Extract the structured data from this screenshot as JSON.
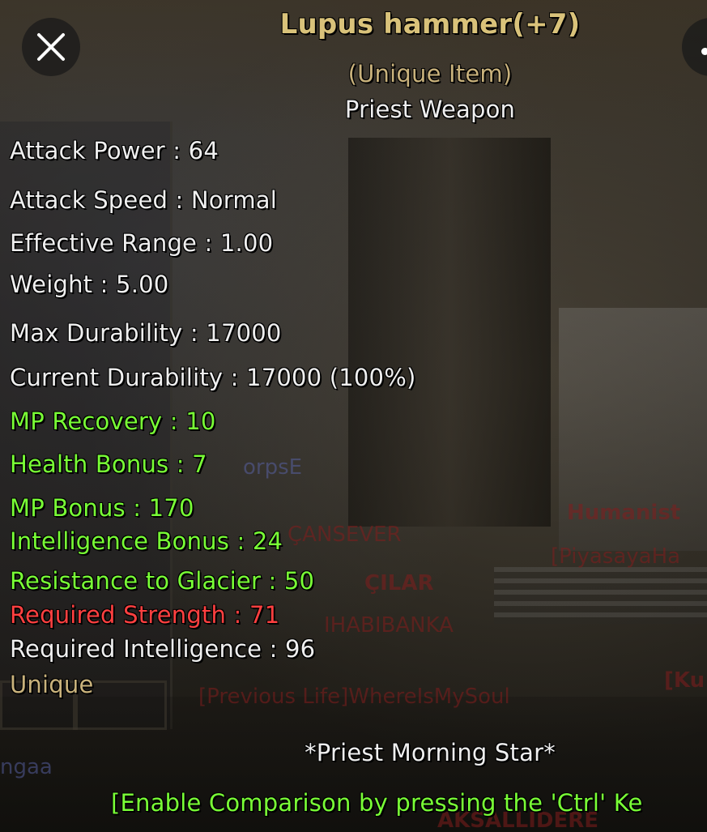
{
  "colors": {
    "title": "#d9c27a",
    "subtitle": "#c9b27c",
    "white": "#efefef",
    "green": "#79ff36",
    "red": "#ff4040",
    "tan": "#c9b27c"
  },
  "icons": {
    "close": "close-icon",
    "more": "more-dots-icon"
  },
  "item": {
    "name": "Lupus hammer(+7)",
    "rarity": "(Unique Item)",
    "type": "Priest Weapon",
    "stats": [
      "Attack Power : 64",
      "Attack Speed : Normal",
      "Effective Range : 1.00",
      "Weight : 5.00",
      "Max Durability : 17000",
      "Current Durability : 17000 (100%)"
    ],
    "bonuses": [
      "MP Recovery : 10",
      "Health Bonus : 7",
      "MP Bonus : 170",
      "Intelligence Bonus : 24",
      "Resistance to Glacier : 50"
    ],
    "required_strength": "Required Strength : 71",
    "required_intelligence": "Required Intelligence : 96",
    "grade": "Unique",
    "set_name": "*Priest Morning Star*",
    "compare_hint": "[Enable Comparison by pressing the 'Ctrl' Ke"
  },
  "background_names": [
    "Humanist",
    "[PiyasayaHa",
    "ÇILAR",
    "IHABIBANKA",
    "[Previous Life]WhereIsMySoul",
    "[Ku",
    "ÇANSEVER",
    "orpsE",
    "AKSALLIDERE",
    "ngaa"
  ]
}
